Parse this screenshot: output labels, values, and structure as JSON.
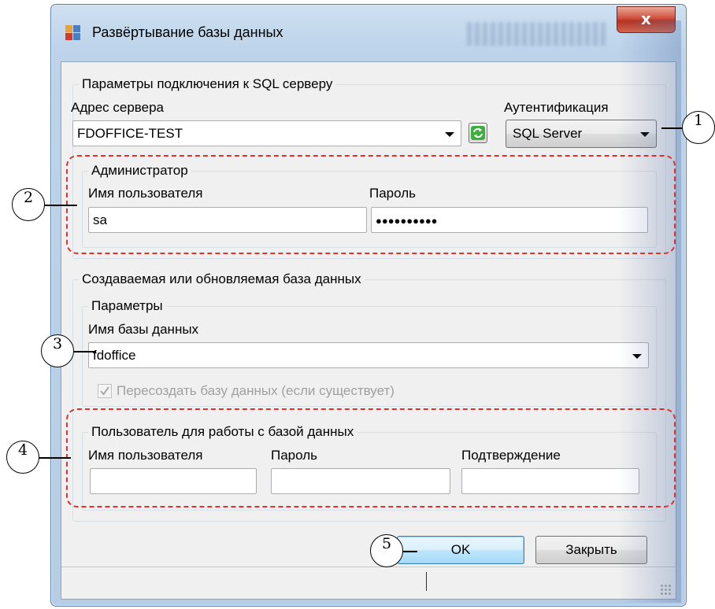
{
  "window": {
    "title": "Развёртывание базы данных",
    "close_symbol": "x",
    "icon": "database-app-icon"
  },
  "sql_connection": {
    "legend": "Параметры подключения к SQL серверу",
    "server_label": "Адрес сервера",
    "server_value": "FDOFFICE-TEST",
    "auth_label": "Аутентификация",
    "auth_value": "SQL Server",
    "admin": {
      "legend": "Администратор",
      "username_label": "Имя пользователя",
      "username_value": "sa",
      "password_label": "Пароль",
      "password_value": "●●●●●●●●●●"
    }
  },
  "database": {
    "legend": "Создаваемая или обновляемая база данных",
    "params": {
      "legend": "Параметры",
      "dbname_label": "Имя базы данных",
      "dbname_value": "fdoffice",
      "recreate_label": "Пересоздать базу данных (если существует)",
      "recreate_checked": true
    },
    "db_user": {
      "legend": "Пользователь для работы с базой данных",
      "username_label": "Имя пользователя",
      "password_label": "Пароль",
      "confirm_label": "Подтверждение"
    }
  },
  "buttons": {
    "ok": "OK",
    "close": "Закрыть"
  },
  "callouts": [
    "1",
    "2",
    "3",
    "4",
    "5"
  ],
  "colors": {
    "highlight_dash": "#e0312f",
    "default_button": "#3c7fb1",
    "close_button": "#c8402e"
  }
}
